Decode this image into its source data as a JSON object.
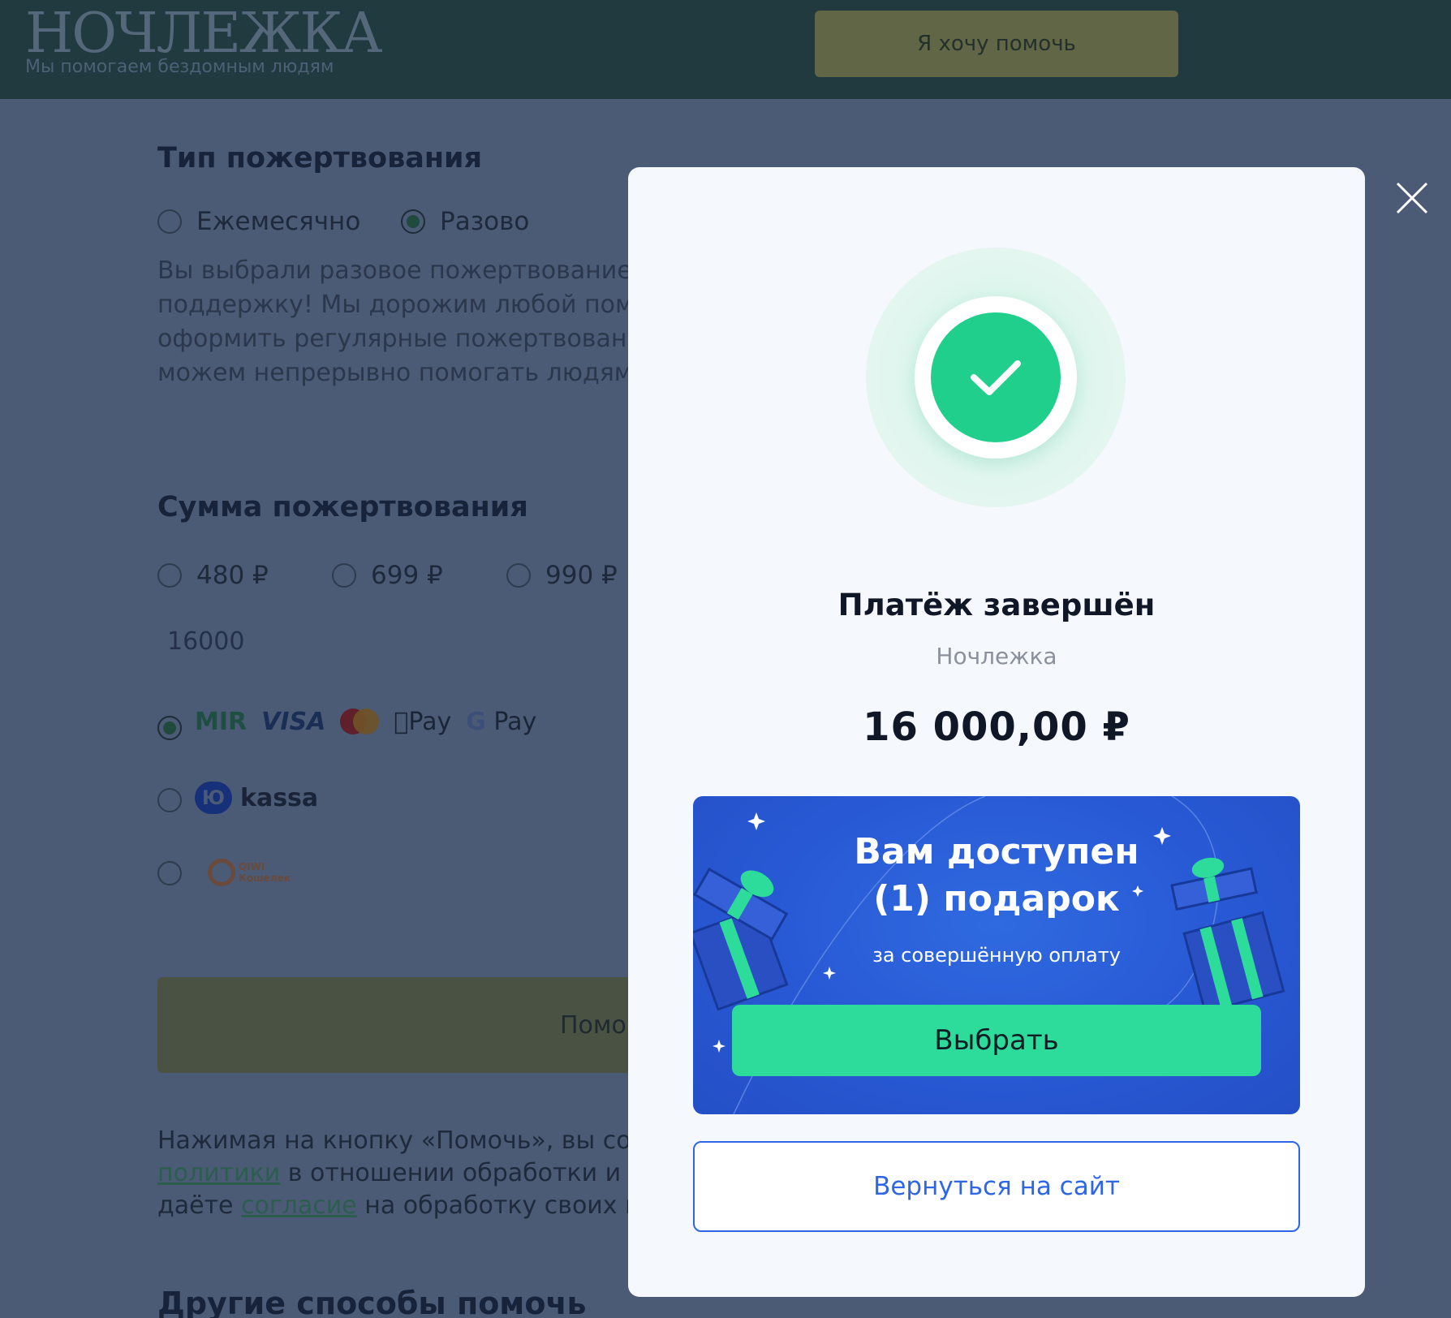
{
  "header": {
    "logo": "НОЧЛЕЖКА",
    "tagline": "Мы помогаем бездомным людям",
    "cta_label": "Я хочу помочь"
  },
  "donation_type": {
    "title": "Тип пожертвования",
    "options": [
      "Ежемесячно",
      "Разово"
    ],
    "selected": "Разово",
    "description_lines": [
      "Вы выбрали разовое пожертвование",
      "поддержку! Мы дорожим любой помо",
      "оформить регулярные пожертвовани",
      "можем непрерывно помогать людям"
    ]
  },
  "donation_amount": {
    "title": "Сумма пожертвования",
    "options": [
      "480 ₽",
      "699 ₽",
      "990 ₽"
    ],
    "custom_value": "16000"
  },
  "payment_methods": {
    "card_logos": [
      "MIR",
      "VISA",
      "mastercard",
      "Pay",
      "G",
      "Pay"
    ],
    "kassa": "kassa",
    "kassa_mark": "Ю",
    "qiwi_lines": [
      "QIWI",
      "Кошелек"
    ]
  },
  "help_button_label": "Помо",
  "consent": {
    "line1": "Нажимая на кнопку «Помочь», вы сог",
    "link1": "политики",
    "line2_rest": " в отношении обработки и",
    "line3_start": "даёте ",
    "link2": "согласие",
    "line3_rest": " на обработку своих п"
  },
  "other_title": "Другие способы помочь",
  "modal": {
    "close_icon": "close-icon",
    "status_icon": "check-icon",
    "title": "Платёж завершён",
    "merchant": "Ночлежка",
    "amount": "16 000,00 ₽",
    "gift": {
      "title_line1": "Вам доступен",
      "title_line2": "(1) подарок",
      "subtitle": "за совершённую оплату",
      "button_label": "Выбрать"
    },
    "back_button_label": "Вернуться на сайт"
  },
  "colors": {
    "accent_blue": "#2f66e6",
    "success_green": "#1fcf8b",
    "gift_button": "#2ddc9a"
  }
}
